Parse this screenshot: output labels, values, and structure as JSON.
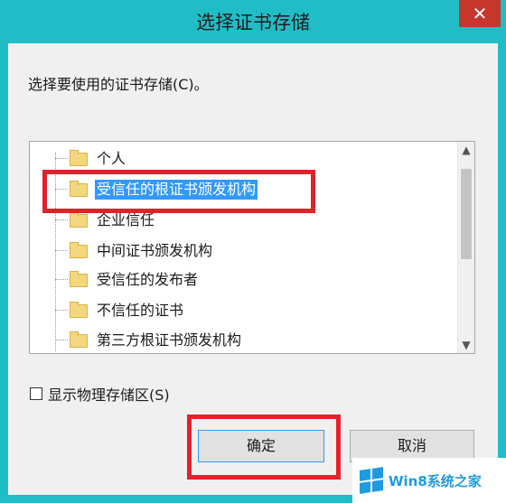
{
  "window": {
    "title": "选择证书存储",
    "close_label": "✕"
  },
  "prompt": "选择要使用的证书存储(C)。",
  "tree": {
    "items": [
      {
        "label": "个人",
        "selected": false
      },
      {
        "label": "受信任的根证书颁发机构",
        "selected": true
      },
      {
        "label": "企业信任",
        "selected": false
      },
      {
        "label": "中间证书颁发机构",
        "selected": false
      },
      {
        "label": "受信任的发布者",
        "selected": false
      },
      {
        "label": "不信任的证书",
        "selected": false
      },
      {
        "label": "第三方根证书颁发机构",
        "selected": false
      }
    ],
    "scroll_up": "▲",
    "scroll_down": "▼"
  },
  "checkbox": {
    "label": "显示物理存储区(S)",
    "checked": false
  },
  "buttons": {
    "ok": "确定",
    "cancel": "取消"
  },
  "watermark": {
    "text": "Win8系统之家"
  },
  "colors": {
    "title_bg": "#21bdc6",
    "selection": "#3399ff",
    "annotation_red": "#e3212b",
    "close": "#c7362b"
  }
}
